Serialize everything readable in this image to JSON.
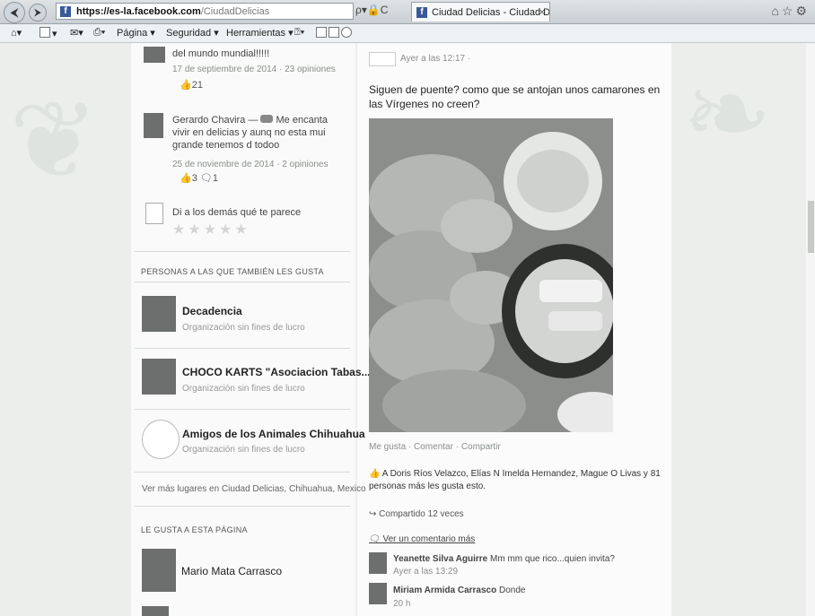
{
  "browser": {
    "url_host": "https://es-la.facebook.com",
    "url_path": "/CiudadDelicias",
    "url_tools": "ρ▾🔒C",
    "tab_title": "Ciudad Delicias - Ciudad D...",
    "tab_close": "×",
    "toolbar": {
      "pagina": "Página ▾",
      "seguridad": "Seguridad ▾",
      "herramientas": "Herramientas ▾"
    }
  },
  "left": {
    "review1": {
      "text": "del mundo mundial!!!!!",
      "meta": "17 de septiembre de 2014 · 23 opiniones",
      "likes": "21"
    },
    "review2": {
      "author": "Gerardo Chavira —",
      "text": "Me encanta vivir en delicias y aunq no esta mui grande tenemos d todoo",
      "meta": "25 de noviembre de 2014 · 2 opiniones",
      "likes": "3",
      "comments": "1"
    },
    "prompt": "Di a los demás qué te parece",
    "stars": "★★★★★",
    "liked_title": "PERSONAS A LAS QUE TAMBIÉN LES GUSTA",
    "places": [
      {
        "name": "Decadencia",
        "sub": "Organización sin fines de lucro"
      },
      {
        "name": "CHOCO KARTS \"Asociacion Tabas...",
        "sub": "Organización sin fines de lucro"
      },
      {
        "name": "Amigos de los Animales Chihuahua",
        "sub": "Organización sin fines de lucro"
      }
    ],
    "see_more": "Ver más lugares en Ciudad Delicias, Chihuahua, Mexico",
    "likes_page_title": "LE GUSTA A ESTA PÁGINA",
    "liked_person": "Mario Mata Carrasco"
  },
  "post": {
    "time": "Ayer a las 12:17 ·",
    "text": "Siguen de puente? como que se antojan unos camarones en las Vírgenes no creen?",
    "actions": "Me gusta · Comentar · Compartir",
    "likers": "A Doris Ríos Velazco, Elías N Imelda Hernandez, Mague O Livas y 81 personas más les gusta esto.",
    "shared": "Compartido 12 veces",
    "view_comment": "Ver un comentario más",
    "comments": [
      {
        "author": "Yeanette Silva Aguirre",
        "text": "Mm mm que rico...quien invita?",
        "time": "Ayer a las 13:29"
      },
      {
        "author": "Miriam Armida Carrasco",
        "text": "Donde",
        "time": "20 h"
      }
    ]
  }
}
